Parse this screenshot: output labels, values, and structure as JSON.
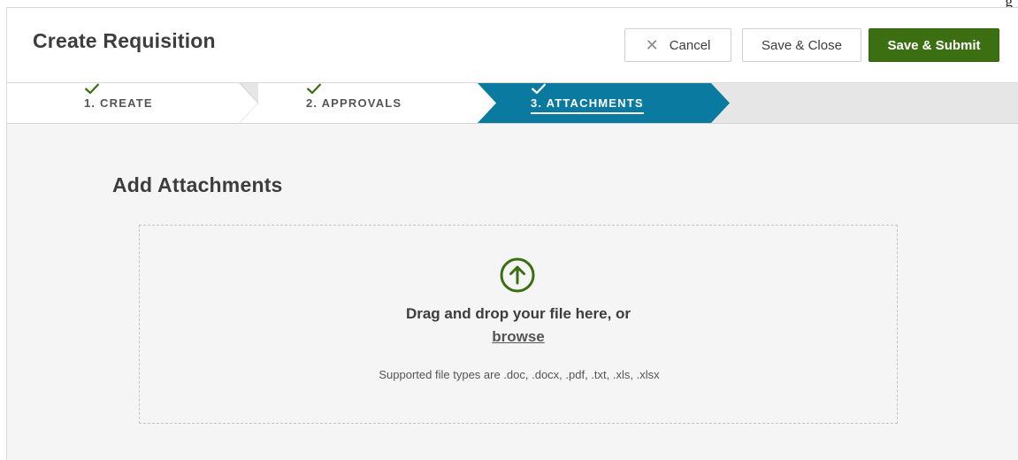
{
  "top_fragment": "g",
  "header": {
    "title": "Create Requisition",
    "cancel_label": "Cancel",
    "save_close_label": "Save & Close",
    "submit_label": "Save & Submit"
  },
  "steps": [
    {
      "label": "1. CREATE",
      "completed": true,
      "active": false
    },
    {
      "label": "2. APPROVALS",
      "completed": true,
      "active": false
    },
    {
      "label": "3. ATTACHMENTS",
      "completed": true,
      "active": true
    }
  ],
  "attachments": {
    "title": "Add Attachments",
    "drop_text": "Drag and drop your file here, or",
    "browse_label": "browse",
    "supported_text": "Supported file types are .doc, .docx, .pdf, .txt, .xls, .xlsx"
  },
  "colors": {
    "primary_green": "#3c6e12",
    "active_step_blue": "#0a7aa0",
    "check_green": "#3c6e12"
  },
  "icons": {
    "cancel": "close-icon",
    "step_done": "check-icon",
    "upload": "upload-arrow-icon"
  }
}
